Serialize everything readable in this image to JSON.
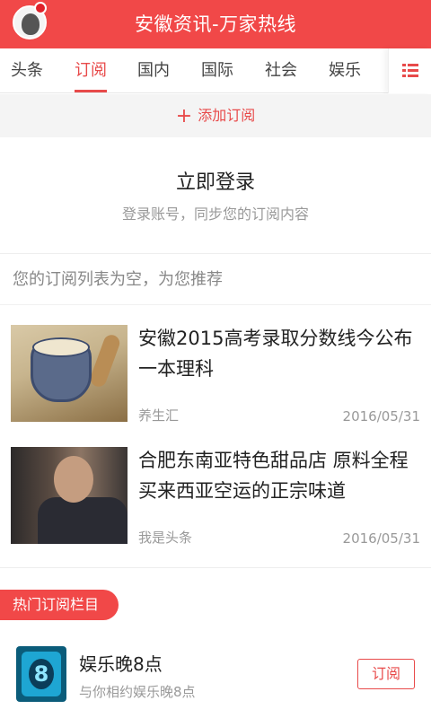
{
  "header": {
    "title": "安徽资讯-万家热线"
  },
  "tabs": {
    "items": [
      {
        "label": "头条"
      },
      {
        "label": "订阅"
      },
      {
        "label": "国内"
      },
      {
        "label": "国际"
      },
      {
        "label": "社会"
      },
      {
        "label": "娱乐"
      }
    ],
    "active": "订阅"
  },
  "add_subscription": {
    "label": "添加订阅"
  },
  "login": {
    "title": "立即登录",
    "subtitle": "登录账号，同步您的订阅内容"
  },
  "empty_hint": "您的订阅列表为空，为您推荐",
  "articles": [
    {
      "title": "安徽2015高考录取分数线今公布 一本理科",
      "source": "养生汇",
      "date": "2016/05/31"
    },
    {
      "title": "合肥东南亚特色甜品店 原料全程买来西亚空运的正宗味道",
      "source": "我是头条",
      "date": "2016/05/31"
    }
  ],
  "hot_section": {
    "label": "热门订阅栏目",
    "channels": [
      {
        "name": "娱乐晚8点",
        "description": "与你相约娱乐晚8点",
        "icon_text": "8",
        "button_label": "订阅"
      }
    ]
  },
  "colors": {
    "brand": "#f14848",
    "accent": "#e84a4a"
  }
}
